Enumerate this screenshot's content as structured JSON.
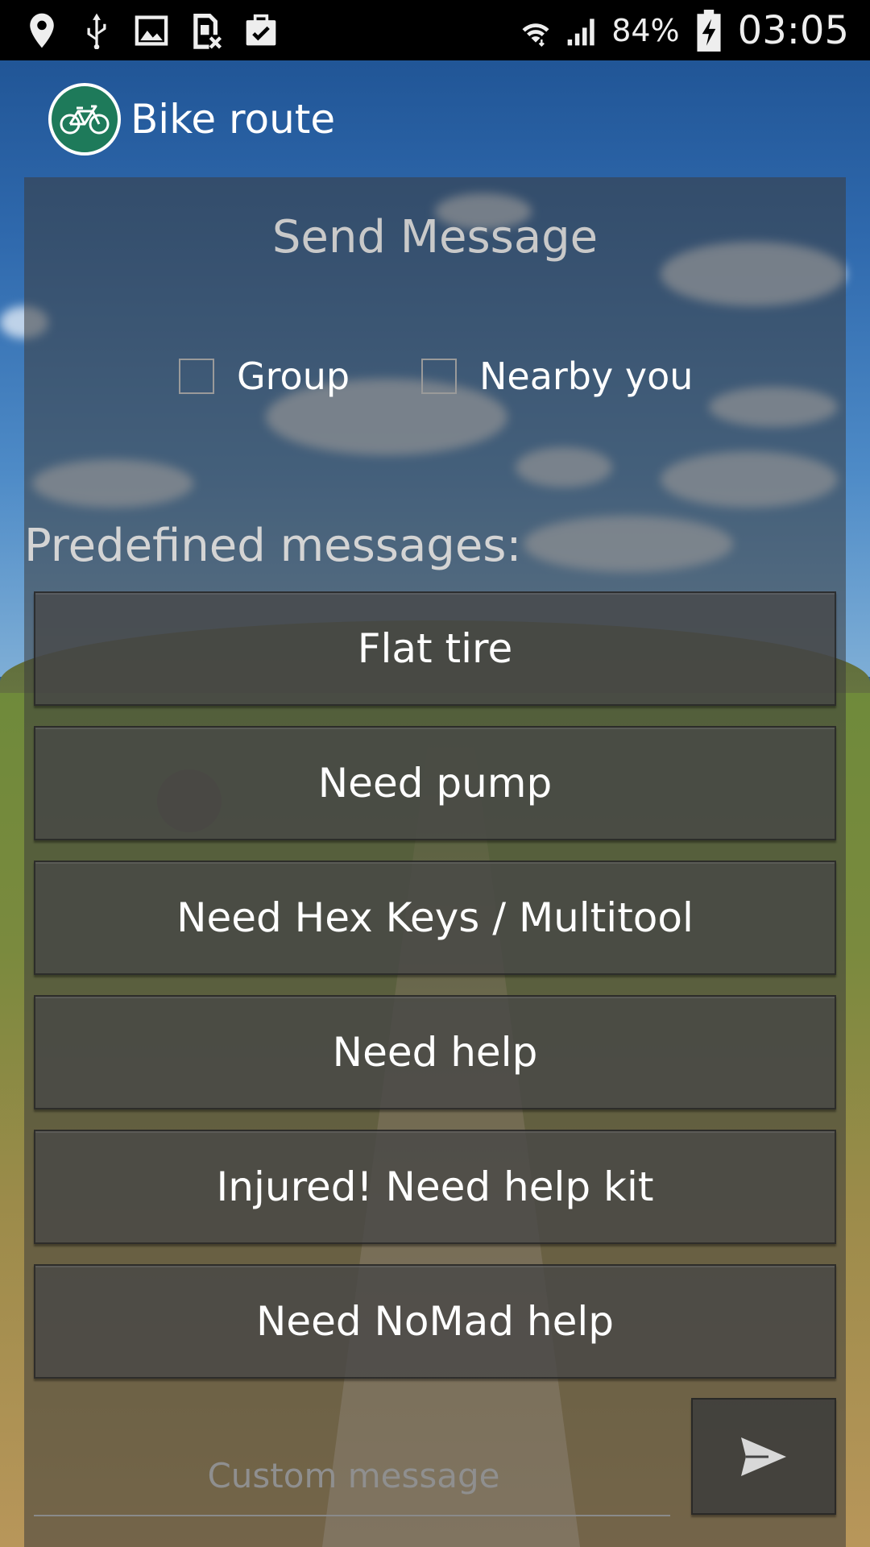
{
  "status_bar": {
    "icons": [
      "location-icon",
      "usb-icon",
      "image-icon",
      "sim-blocked-icon",
      "clipboard-check-icon"
    ],
    "battery_percent": "84%",
    "time": "03:05"
  },
  "app": {
    "title": "Bike route",
    "logo_icon": "bicycle-icon",
    "accent": "#1e7a5a"
  },
  "panel": {
    "title": "Send Message",
    "options": [
      {
        "label": "Group",
        "checked": false
      },
      {
        "label": "Nearby you",
        "checked": false
      }
    ],
    "predefined_label": "Predefined messages:",
    "messages": [
      "Flat tire",
      "Need pump",
      "Need Hex Keys / Multitool",
      "Need help",
      "Injured! Need help kit",
      "Need NoMad help"
    ],
    "custom": {
      "placeholder": "Custom message",
      "value": ""
    },
    "send_icon": "send-icon"
  }
}
